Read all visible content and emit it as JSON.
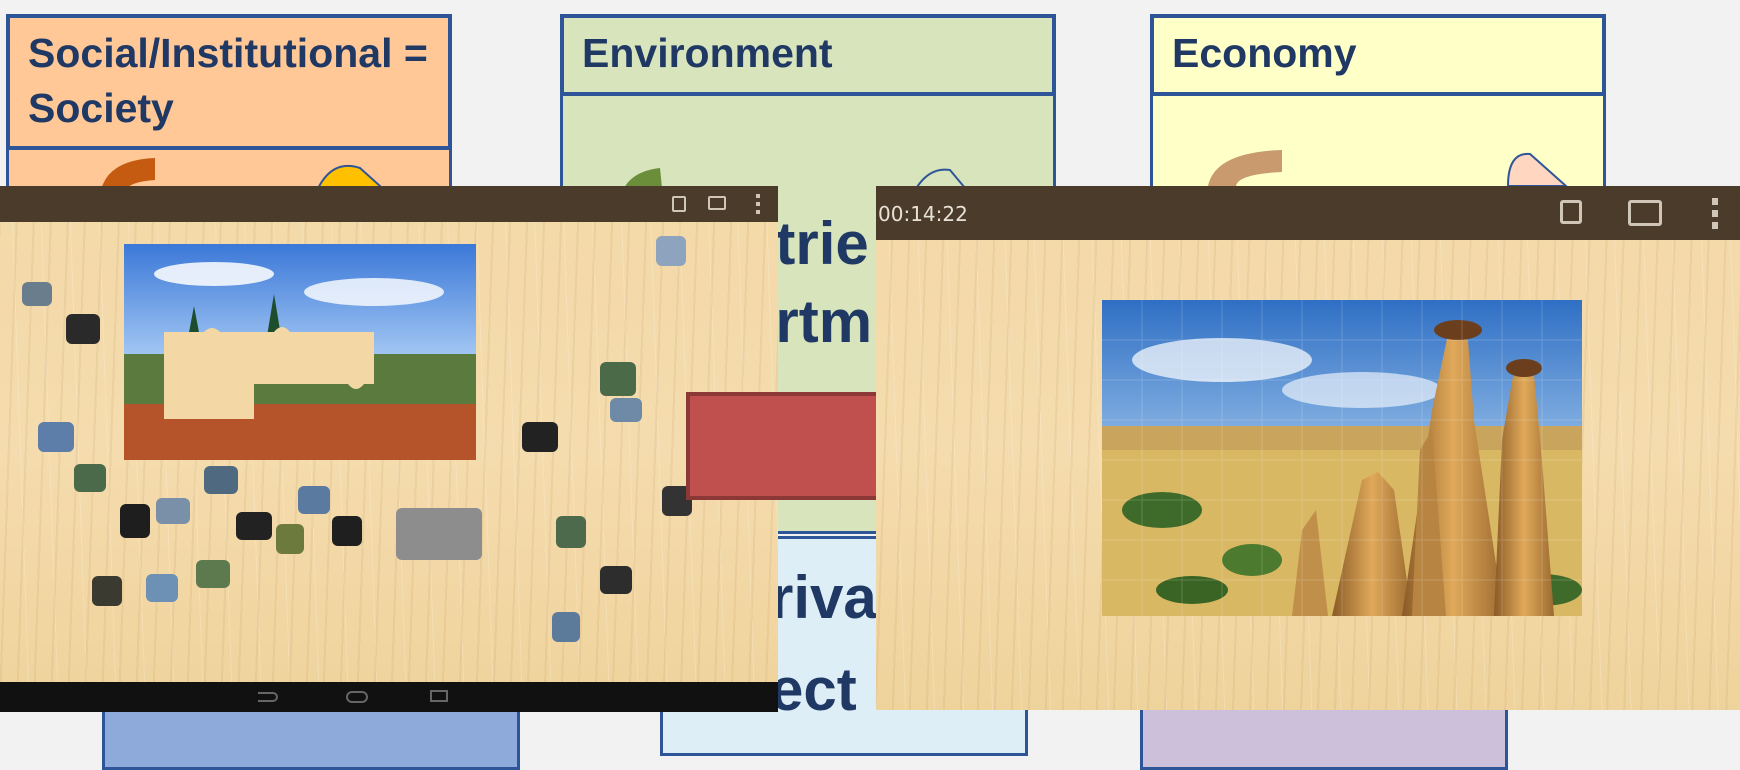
{
  "categories": {
    "social": {
      "title": "Social/Institutional = Society",
      "color": "#ffc896"
    },
    "environment": {
      "title": "Environment",
      "color": "#d8e4bc"
    },
    "economy": {
      "title": "Economy",
      "color": "#ffffc8"
    }
  },
  "background_words": {
    "industries_fragment": "strie",
    "departments_fragment": "artm",
    "private_fragment": "riva",
    "sector_fragment": "ect"
  },
  "left_screenshot": {
    "icons": [
      "lock-icon",
      "image-icon",
      "overflow-menu-icon"
    ],
    "nav_icons": [
      "back-icon",
      "home-icon",
      "recent-apps-icon"
    ]
  },
  "right_screenshot": {
    "timer": "00:14:22",
    "icons": [
      "lock-icon",
      "image-icon",
      "overflow-menu-icon"
    ]
  },
  "colors": {
    "arrow_fill": "#c0504d",
    "arrow_stroke": "#8c3836",
    "box_border": "#2e5597",
    "title_text": "#1f3864"
  }
}
